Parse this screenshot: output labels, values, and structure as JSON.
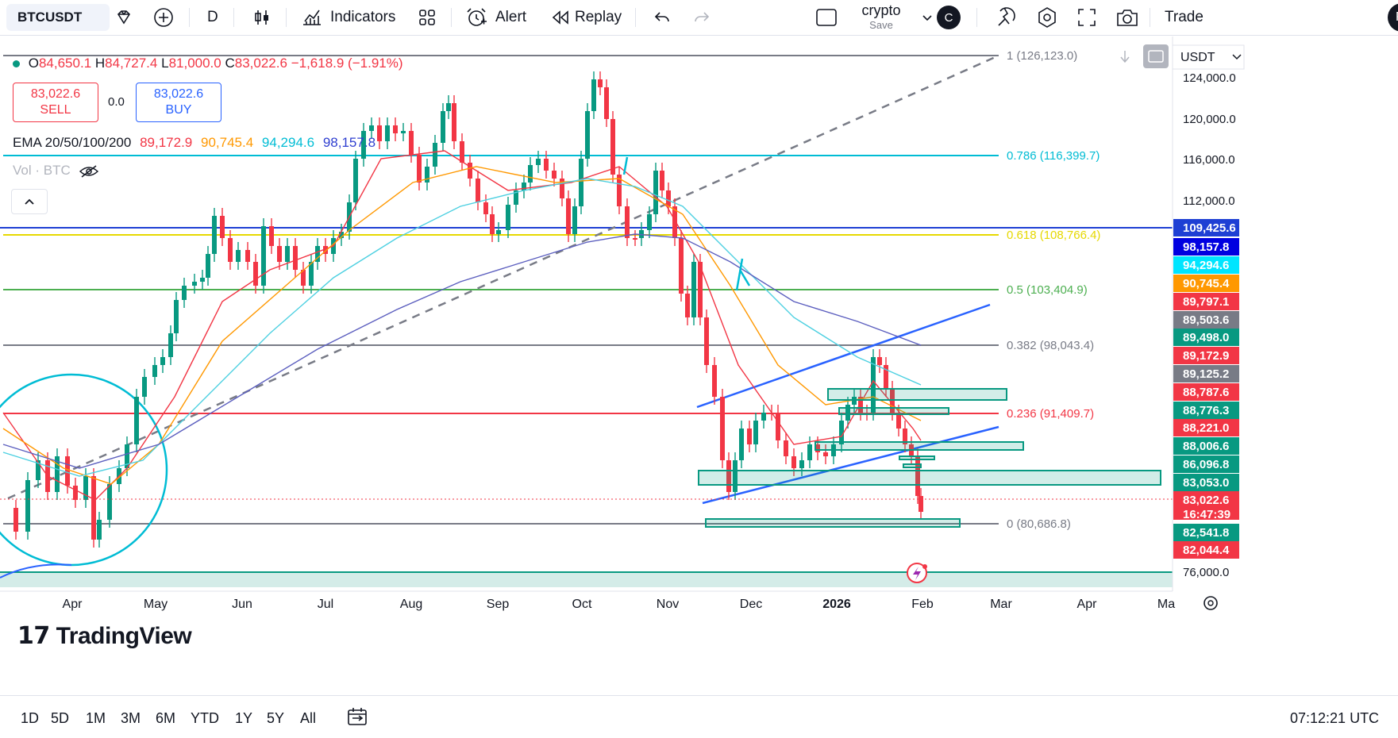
{
  "toolbar": {
    "symbol": "BTCUSDT",
    "interval": "D",
    "indicators_label": "Indicators",
    "alert_label": "Alert",
    "replay_label": "Replay",
    "layout_name": "crypto",
    "layout_save": "Save",
    "avatar_letter": "C",
    "trade_label": "Trade",
    "profile_letter": "P"
  },
  "legend": {
    "open_label": "O",
    "open": "84,650.1",
    "high_label": "H",
    "high": "84,727.4",
    "low_label": "L",
    "low": "81,000.0",
    "close_label": "C",
    "close": "83,022.6",
    "change": "−1,618.9 (−1.91%)",
    "sell_price": "83,022.6",
    "sell_label": "SELL",
    "spread": "0.0",
    "buy_price": "83,022.6",
    "buy_label": "BUY",
    "ema_label": "EMA 20/50/100/200",
    "ema20": "89,172.9",
    "ema50": "90,745.4",
    "ema100": "94,294.6",
    "ema200": "98,157.8",
    "vol_label": "Vol · BTC"
  },
  "currency": "USDT",
  "watermark": "TradingView",
  "price_axis": [
    "124,000.0",
    "120,000.0",
    "116,000.0",
    "112,000.0",
    "76,000.0"
  ],
  "price_tags": [
    {
      "text": "109,425.6",
      "color": "#1e3fd4"
    },
    {
      "text": "98,157.8",
      "color": "#0000e0"
    },
    {
      "text": "94,294.6",
      "color": "#00e5ff"
    },
    {
      "text": "90,745.4",
      "color": "#ff9800"
    },
    {
      "text": "89,797.1",
      "color": "#f23645"
    },
    {
      "text": "89,503.6",
      "color": "#787b86"
    },
    {
      "text": "89,498.0",
      "color": "#089981"
    },
    {
      "text": "89,172.9",
      "color": "#f23645"
    },
    {
      "text": "89,125.2",
      "color": "#787b86"
    },
    {
      "text": "88,787.6",
      "color": "#f23645"
    },
    {
      "text": "88,776.3",
      "color": "#089981"
    },
    {
      "text": "88,221.0",
      "color": "#f23645"
    },
    {
      "text": "88,006.6",
      "color": "#089981"
    },
    {
      "text": "86,096.8",
      "color": "#089981"
    },
    {
      "text": "83,053.0",
      "color": "#089981"
    },
    {
      "text": "83,022.6",
      "color": "#f23645"
    },
    {
      "text": "16:47:39",
      "color": "#f23645"
    },
    {
      "text": "82,541.8",
      "color": "#089981"
    },
    {
      "text": "82,044.4",
      "color": "#f23645"
    }
  ],
  "fib_levels": [
    {
      "text": "1 (126,123.0)",
      "color": "#787b86"
    },
    {
      "text": "0.786 (116,399.7)",
      "color": "#00bcd4"
    },
    {
      "text": "0.618 (108,766.4)",
      "color": "#e6d800"
    },
    {
      "text": "0.5 (103,404.9)",
      "color": "#4caf50"
    },
    {
      "text": "0.382 (98,043.4)",
      "color": "#787b86"
    },
    {
      "text": "0.236 (91,409.7)",
      "color": "#f23645"
    },
    {
      "text": "0 (80,686.8)",
      "color": "#787b86"
    }
  ],
  "time_axis": [
    "Apr",
    "May",
    "Jun",
    "Jul",
    "Aug",
    "Sep",
    "Oct",
    "Nov",
    "Dec",
    "2026",
    "Feb",
    "Mar",
    "Apr",
    "Ma"
  ],
  "ranges": [
    "1D",
    "5D",
    "1M",
    "3M",
    "6M",
    "YTD",
    "1Y",
    "5Y",
    "All"
  ],
  "clock": "07:12:21 UTC",
  "colors": {
    "up": "#089981",
    "down": "#f23645",
    "ema20": "#f23645",
    "ema50": "#ff9800",
    "ema100": "#4dd0e1",
    "ema200": "#5c5fbf"
  }
}
